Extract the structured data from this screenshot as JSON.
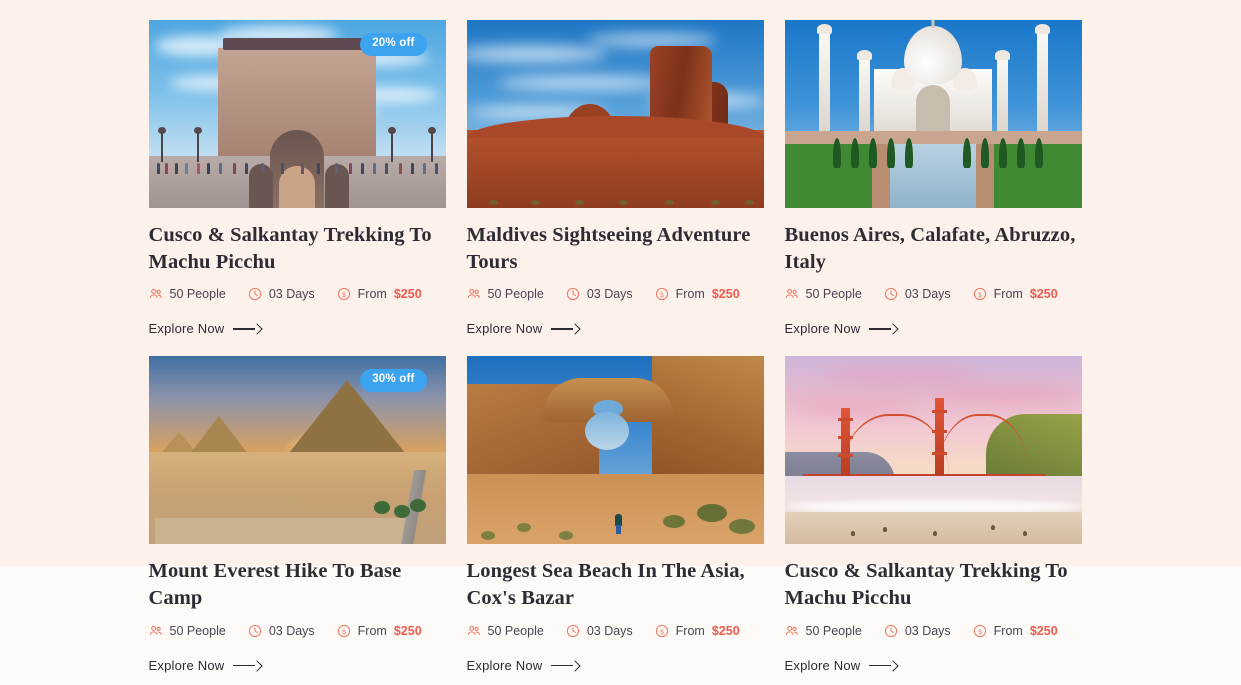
{
  "page": {
    "background_color": "#fdf1ec",
    "accent_color": "#ef5b4c",
    "badge_color": "#3ba3ef"
  },
  "cards": [
    {
      "title": "Cusco & Salkantay Trekking To Machu Picchu",
      "badge": "20% off",
      "people": "50 People",
      "duration": "03 Days",
      "price_prefix": "From",
      "price": "$250",
      "cta": "Explore Now",
      "image_alt": "gateway-of-india-monument"
    },
    {
      "title": "Maldives Sightseeing Adventure Tours",
      "badge": "",
      "people": "50 People",
      "duration": "03 Days",
      "price_prefix": "From",
      "price": "$250",
      "cta": "Explore Now",
      "image_alt": "red-rock-butte-desert"
    },
    {
      "title": "Buenos Aires, Calafate, Abruzzo, Italy",
      "badge": "",
      "people": "50 People",
      "duration": "03 Days",
      "price_prefix": "From",
      "price": "$250",
      "cta": "Explore Now",
      "image_alt": "taj-mahal-reflecting-pool"
    },
    {
      "title": "Mount Everest Hike To Base Camp",
      "badge": "30% off",
      "people": "50 People",
      "duration": "03 Days",
      "price_prefix": "From",
      "price": "$250",
      "cta": "Explore Now",
      "image_alt": "giza-pyramids-sunset"
    },
    {
      "title": "Longest Sea Beach In The Asia, Cox's Bazar",
      "badge": "",
      "people": "50 People",
      "duration": "03 Days",
      "price_prefix": "From",
      "price": "$250",
      "cta": "Explore Now",
      "image_alt": "sandstone-arch-hiker"
    },
    {
      "title": "Cusco & Salkantay Trekking To Machu Picchu",
      "badge": "",
      "people": "50 People",
      "duration": "03 Days",
      "price_prefix": "From",
      "price": "$250",
      "cta": "Explore Now",
      "image_alt": "golden-gate-bridge-beach"
    }
  ]
}
